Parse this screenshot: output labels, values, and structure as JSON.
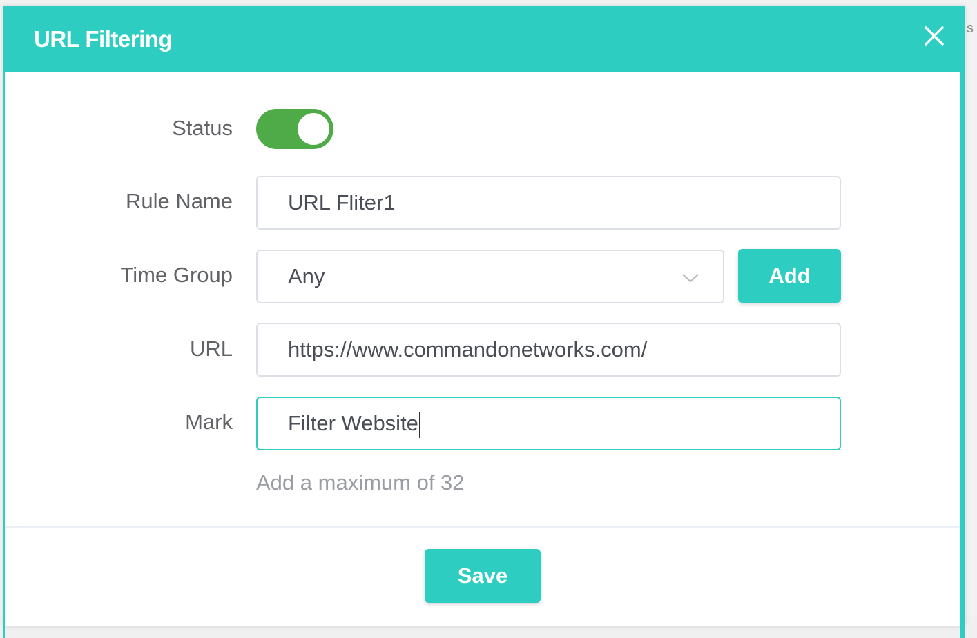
{
  "dialog": {
    "title": "URL Filtering",
    "close_icon": "close-icon"
  },
  "background": {
    "peek_text": "s"
  },
  "form": {
    "status": {
      "label": "Status",
      "enabled": true
    },
    "rule_name": {
      "label": "Rule Name",
      "value": "URL Fliter1"
    },
    "time_group": {
      "label": "Time Group",
      "selected": "Any",
      "add_label": "Add"
    },
    "url": {
      "label": "URL",
      "value": "https://www.commandonetworks.com/"
    },
    "mark": {
      "label": "Mark",
      "value": "Filter Website",
      "hint": "Add a maximum of 32"
    }
  },
  "footer": {
    "save_label": "Save"
  },
  "colors": {
    "accent": "#2ecdc2",
    "toggle_on": "#4faa48",
    "label_text": "#606266",
    "hint_text": "#9a9ca3"
  }
}
